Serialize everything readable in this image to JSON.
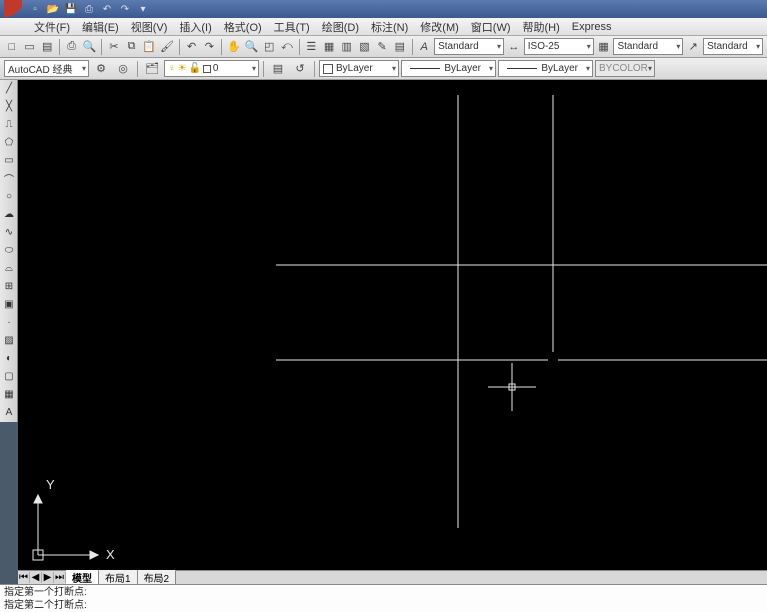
{
  "menubar": {
    "items": [
      "文件(F)",
      "编辑(E)",
      "视图(V)",
      "插入(I)",
      "格式(O)",
      "工具(T)",
      "绘图(D)",
      "标注(N)",
      "修改(M)",
      "窗口(W)",
      "帮助(H)",
      "Express"
    ]
  },
  "toolbar1": {
    "text_style": "Standard",
    "dim_style": "ISO-25",
    "table_style": "Standard",
    "mleader_style": "Standard"
  },
  "toolbar2": {
    "workspace": "AutoCAD 经典",
    "layer_name": "0",
    "properties_layer": "ByLayer",
    "linetype": "ByLayer",
    "lineweight": "ByLayer",
    "bycolor": "BYCOLOR"
  },
  "tabs": {
    "model": "模型",
    "layout1": "布局1",
    "layout2": "布局2"
  },
  "cmdline": {
    "line1": "指定第一个打断点:",
    "line2": "指定第二个打断点:"
  },
  "ucs": {
    "x": "X",
    "y": "Y"
  }
}
